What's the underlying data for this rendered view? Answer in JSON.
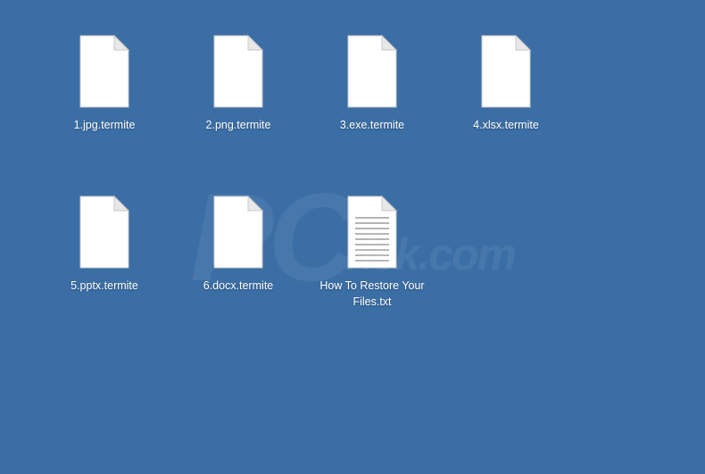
{
  "files": [
    {
      "label": "1.jpg.termite",
      "icon": "blank"
    },
    {
      "label": "2.png.termite",
      "icon": "blank"
    },
    {
      "label": "3.exe.termite",
      "icon": "blank"
    },
    {
      "label": "4.xlsx.termite",
      "icon": "blank"
    },
    {
      "label": "5.pptx.termite",
      "icon": "blank"
    },
    {
      "label": "6.docx.termite",
      "icon": "blank"
    },
    {
      "label": "How To Restore Your Files.txt",
      "icon": "text"
    }
  ],
  "watermark": {
    "main": "PC",
    "sub": "risk.com"
  }
}
